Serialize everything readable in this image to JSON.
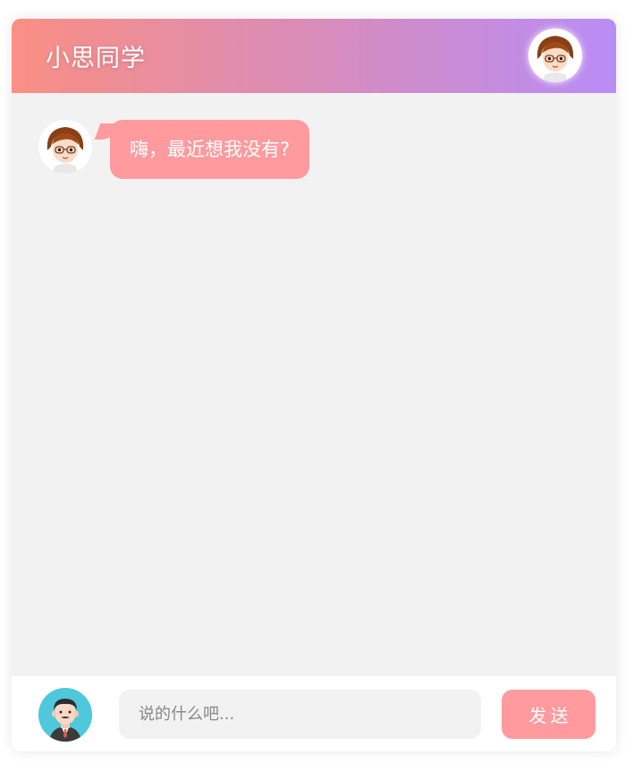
{
  "header": {
    "title": "小思同学",
    "avatar_icon": "girl-avatar-icon"
  },
  "messages": [
    {
      "sender": "bot",
      "avatar_icon": "girl-avatar-icon",
      "text": "嗨，最近想我没有?"
    }
  ],
  "composer": {
    "user_avatar_icon": "boy-avatar-icon",
    "placeholder": "说的什么吧...",
    "value": "",
    "send_label": "发送"
  },
  "colors": {
    "header_gradient_start": "#fa8f84",
    "header_gradient_end": "#b98cf6",
    "bubble": "#ff9a9e",
    "send_button": "#ff9a9e",
    "chat_background": "#f2f2f2",
    "user_avatar_background": "#4fc8dc"
  }
}
